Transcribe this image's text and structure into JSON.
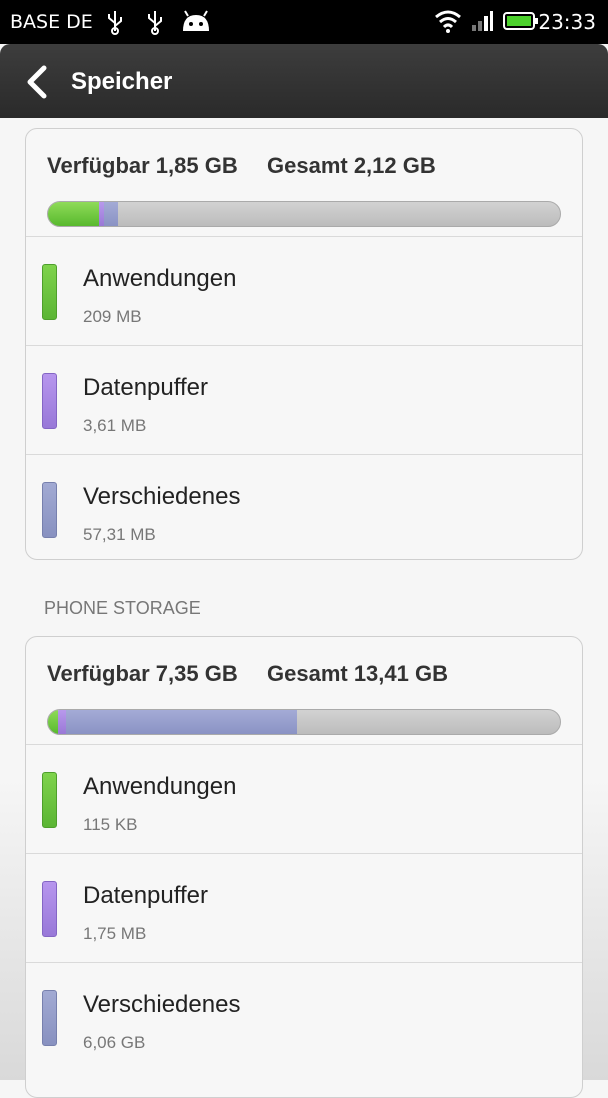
{
  "status_bar": {
    "carrier": "BASE DE",
    "time": "23:33",
    "icons": [
      "usb-icon",
      "usb-icon",
      "android-debug-icon",
      "wifi-icon",
      "signal-icon",
      "battery-icon"
    ]
  },
  "header": {
    "title": "Speicher",
    "back_icon": "chevron-left-icon"
  },
  "colors": {
    "apps": "#6cc63c",
    "cache": "#a585e0",
    "misc": "#979fcc"
  },
  "internal": {
    "available": "Verfügbar 1,85 GB",
    "total": "Gesamt 2,12 GB",
    "usage_fractions": {
      "apps": 0.1,
      "cache": 0.01,
      "misc": 0.026
    },
    "rows": [
      {
        "title": "Anwendungen",
        "size": "209 MB"
      },
      {
        "title": "Datenpuffer",
        "size": "3,61 MB"
      },
      {
        "title": "Verschiedenes",
        "size": "57,31 MB"
      }
    ]
  },
  "phone_storage": {
    "label": "PHONE STORAGE",
    "available": "Verfügbar 7,35 GB",
    "total": "Gesamt 13,41 GB",
    "usage_fractions": {
      "apps": 0.02,
      "cache": 0.015,
      "misc": 0.452
    },
    "rows": [
      {
        "title": "Anwendungen",
        "size": "115 KB"
      },
      {
        "title": "Datenpuffer",
        "size": "1,75 MB"
      },
      {
        "title": "Verschiedenes",
        "size": "6,06 GB"
      }
    ]
  }
}
